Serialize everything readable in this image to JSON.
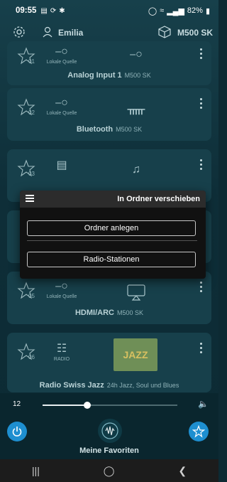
{
  "status": {
    "time": "09:55",
    "battery": "82%"
  },
  "header": {
    "user_name": "Emilia",
    "device_name": "M500 SK"
  },
  "sources": [
    {
      "number": "01",
      "source_caption": "Lokale Quelle",
      "title": "Analog Input 1",
      "device": "M500 SK"
    },
    {
      "number": "02",
      "source_caption": "Lokale Quelle",
      "title": "Bluetooth",
      "device": "M500 SK"
    },
    {
      "number": "03"
    },
    {
      "number": "05",
      "source_caption": "Lokale Quelle",
      "title": "HDMI/ARC",
      "device": "M500 SK"
    },
    {
      "number": "06",
      "source_caption": "RADIO",
      "title": "Radio Swiss Jazz",
      "device": "24h Jazz, Soul und Blues"
    }
  ],
  "dialog": {
    "title": "In Ordner verschieben",
    "create_folder_label": "Ordner anlegen",
    "radio_stations_label": "Radio-Stationen"
  },
  "player": {
    "volume": "12",
    "volume_fraction": 0.33,
    "playlist_name": "Meine Favoriten"
  },
  "colors": {
    "accent": "#1e8fd0",
    "background": "#0d2a33",
    "card": "#17404b"
  }
}
